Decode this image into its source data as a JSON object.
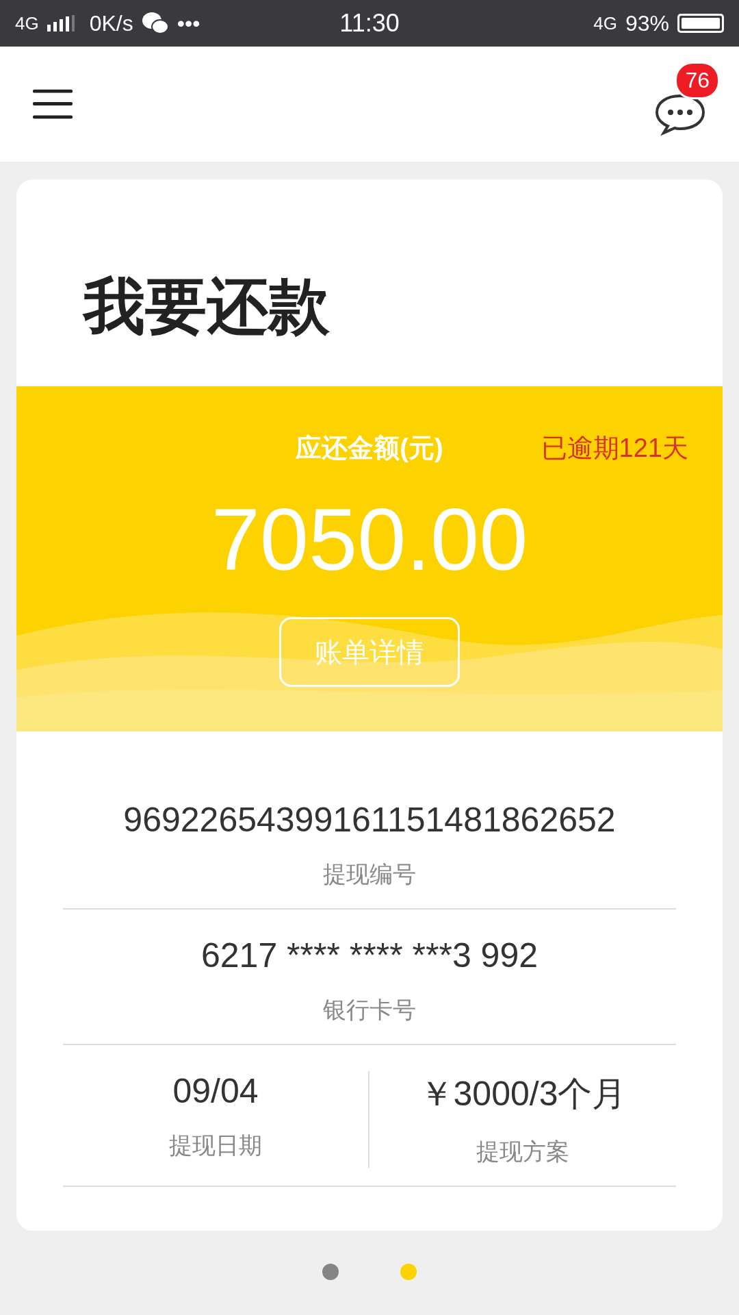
{
  "status_bar": {
    "network": "4G",
    "speed": "0K/s",
    "more": "•••",
    "time": "11:30",
    "network_right": "4G",
    "battery": "93%"
  },
  "header": {
    "badge": "76"
  },
  "card": {
    "title": "我要还款",
    "amount_label": "应还金额(元)",
    "overdue": "已逾期121天",
    "amount": "7050.00",
    "details_button": "账单详情",
    "rows": [
      {
        "value": "96922654399161151481862652",
        "label": "提现编号"
      },
      {
        "value": "6217 **** **** ***3 992",
        "label": "银行卡号"
      }
    ],
    "split": [
      {
        "value": "09/04",
        "label": "提现日期"
      },
      {
        "value": "￥3000/3个月",
        "label": "提现方案"
      }
    ]
  },
  "pager": [
    {
      "selected": false
    },
    {
      "selected": true
    }
  ]
}
